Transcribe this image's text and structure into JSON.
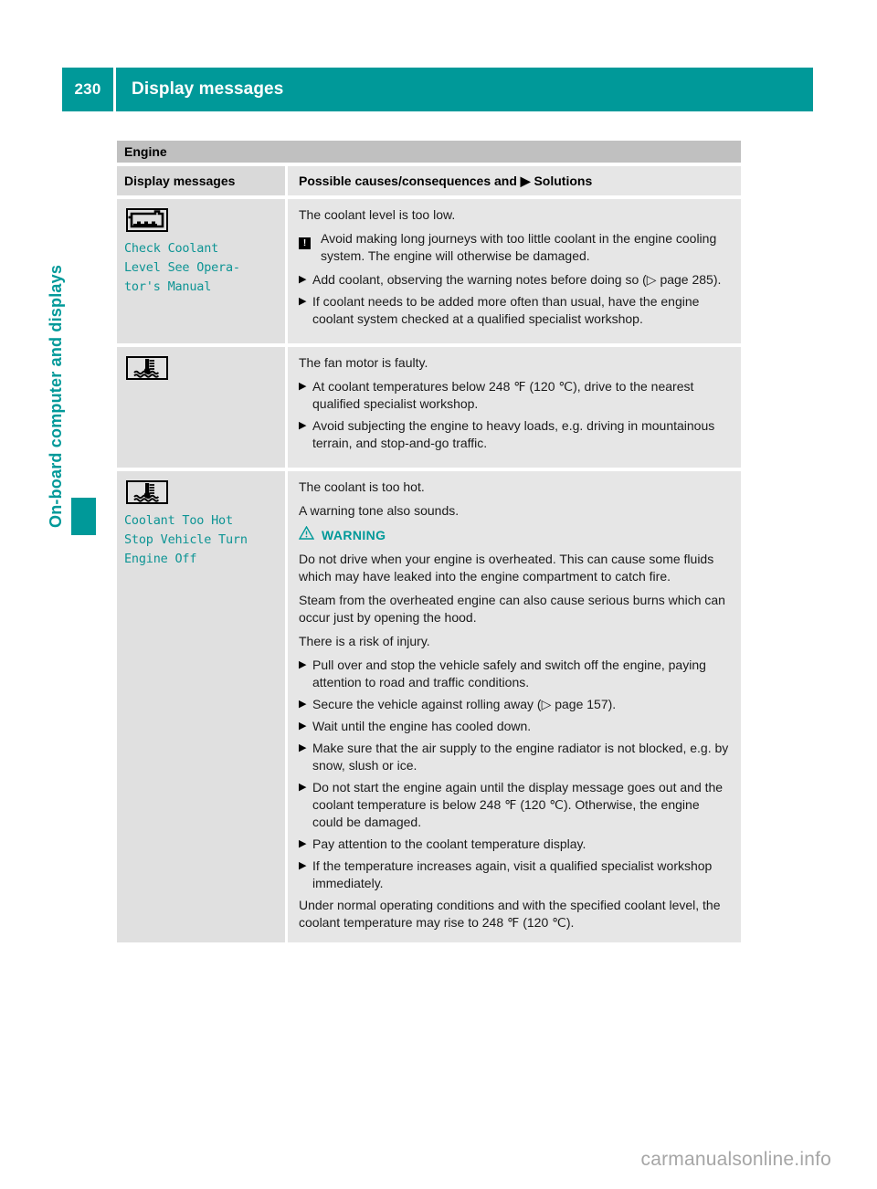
{
  "header": {
    "page_number": "230",
    "title": "Display messages"
  },
  "side_tab": {
    "label": "On-board computer and displays"
  },
  "section": {
    "title": "Engine"
  },
  "table": {
    "columns": {
      "left": "Display messages",
      "right_prefix": "Possible causes/consequences and",
      "right_marker": "▶",
      "right_suffix": "Solutions"
    },
    "rows": [
      {
        "icon": "coolant-reservoir-icon",
        "display_message": "Check Coolant\nLevel See Opera-\ntor's Manual",
        "blocks": [
          {
            "type": "para",
            "text": "The coolant level is too low."
          },
          {
            "type": "note",
            "glyph": "!",
            "text": "Avoid making long journeys with too little coolant in the engine cooling system. The engine will otherwise be damaged."
          },
          {
            "type": "bullet",
            "marker": "▶",
            "text": "Add coolant, observing the warning notes before doing so (▷ page 285)."
          },
          {
            "type": "bullet",
            "marker": "▶",
            "text": "If coolant needs to be added more often than usual, have the engine coolant system checked at a qualified specialist workshop."
          }
        ]
      },
      {
        "icon": "coolant-temperature-icon",
        "display_message": "",
        "blocks": [
          {
            "type": "para",
            "text": "The fan motor is faulty."
          },
          {
            "type": "bullet",
            "marker": "▶",
            "text": "At coolant temperatures below 248 ℉ (120 ℃), drive to the nearest qualified specialist workshop."
          },
          {
            "type": "bullet",
            "marker": "▶",
            "text": "Avoid subjecting the engine to heavy loads, e.g. driving in mountainous terrain, and stop-and-go traffic."
          }
        ]
      },
      {
        "icon": "coolant-temperature-icon",
        "display_message": "Coolant Too Hot\nStop Vehicle Turn\nEngine Off",
        "blocks": [
          {
            "type": "para",
            "text": "The coolant is too hot."
          },
          {
            "type": "para",
            "text": "A warning tone also sounds."
          },
          {
            "type": "warning-heading",
            "label": "WARNING"
          },
          {
            "type": "para",
            "text": "Do not drive when your engine is overheated. This can cause some fluids which may have leaked into the engine compartment to catch fire."
          },
          {
            "type": "para",
            "text": "Steam from the overheated engine can also cause serious burns which can occur just by opening the hood."
          },
          {
            "type": "para",
            "text": "There is a risk of injury."
          },
          {
            "type": "bullet",
            "marker": "▶",
            "text": "Pull over and stop the vehicle safely and switch off the engine, paying attention to road and traffic conditions."
          },
          {
            "type": "bullet",
            "marker": "▶",
            "text": "Secure the vehicle against rolling away (▷ page 157)."
          },
          {
            "type": "bullet",
            "marker": "▶",
            "text": "Wait until the engine has cooled down."
          },
          {
            "type": "bullet",
            "marker": "▶",
            "text": "Make sure that the air supply to the engine radiator is not blocked, e.g. by snow, slush or ice."
          },
          {
            "type": "bullet",
            "marker": "▶",
            "text": "Do not start the engine again until the display message goes out and the coolant temperature is below 248 ℉ (120 ℃). Otherwise, the engine could be damaged."
          },
          {
            "type": "bullet",
            "marker": "▶",
            "text": "Pay attention to the coolant temperature display."
          },
          {
            "type": "bullet",
            "marker": "▶",
            "text": "If the temperature increases again, visit a qualified specialist workshop immediately."
          },
          {
            "type": "para",
            "text": "Under normal operating conditions and with the specified coolant level, the coolant temperature may rise to 248 ℉ (120 ℃)."
          }
        ]
      }
    ]
  },
  "footer": {
    "watermark": "carmanualsonline.info"
  },
  "colors": {
    "accent": "#009999",
    "display_text": "#0d9494",
    "section_band": "#c0c0c0",
    "cell_left": "#e0e0e0",
    "cell_right": "#e6e6e6",
    "watermark": "#a6a6a6"
  }
}
